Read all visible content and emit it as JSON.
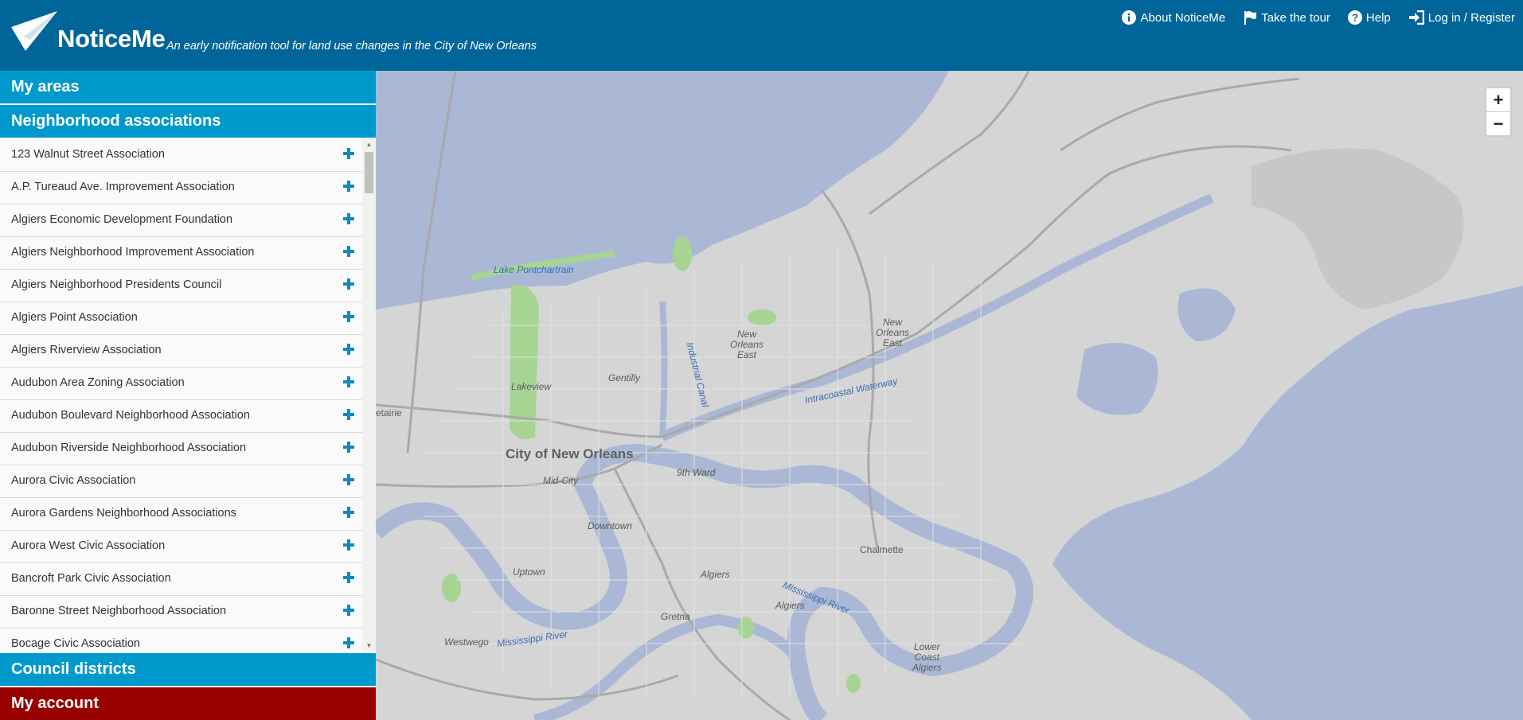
{
  "header": {
    "brand": "NoticeMe",
    "tagline": "An early notification tool for land use changes in the City of New Orleans",
    "nav": [
      {
        "icon": "info-icon",
        "label": "About NoticeMe"
      },
      {
        "icon": "flag-icon",
        "label": "Take the tour"
      },
      {
        "icon": "help-icon",
        "label": "Help"
      },
      {
        "icon": "login-icon",
        "label": "Log in / Register"
      }
    ]
  },
  "sidebar": {
    "my_areas": "My areas",
    "neighborhood_associations": "Neighborhood associations",
    "associations": [
      "123 Walnut Street Association",
      "A.P. Tureaud Ave. Improvement Association",
      "Algiers Economic Development Foundation",
      "Algiers Neighborhood Improvement Association",
      "Algiers Neighborhood Presidents Council",
      "Algiers Point Association",
      "Algiers Riverview Association",
      "Audubon Area Zoning Association",
      "Audubon Boulevard Neighborhood Association",
      "Audubon Riverside Neighborhood Association",
      "Aurora Civic Association",
      "Aurora Gardens Neighborhood Associations",
      "Aurora West Civic Association",
      "Bancroft Park Civic Association",
      "Baronne Street Neighborhood Association",
      "Bocage Civic Association"
    ],
    "council_districts": "Council districts",
    "my_account": "My account"
  },
  "map": {
    "labels": {
      "lake": "Lake Pontchartrain",
      "lakeview": "Lakeview",
      "gentilly": "Gentilly",
      "noe1": "New\nOrleans\nEast",
      "noe2": "New\nOrleans\nEast",
      "industrial_canal": "Industrial Canal",
      "intracoastal": "Intracoastal Waterway",
      "metairie": "etairie",
      "city": "City of New Orleans",
      "midcity": "Mid-City",
      "ninth_ward": "9th Ward",
      "downtown": "Downtown",
      "chalmette": "Chalmette",
      "uptown": "Uptown",
      "algiers1": "Algiers",
      "algiers2": "Algiers",
      "river1": "Mississippi River",
      "river2": "Mississippi River",
      "gretna": "Gretna",
      "westwego": "Westwego",
      "lower_coast": "Lower\nCoast\nAlgiers"
    },
    "zoom_in": "+",
    "zoom_out": "−"
  },
  "colors": {
    "header": "#006699",
    "section": "#0099cc",
    "account": "#990000",
    "plus": "#1a86b8",
    "water": "#aab8d6",
    "land": "#d5d5d5",
    "park": "#a6d492"
  }
}
